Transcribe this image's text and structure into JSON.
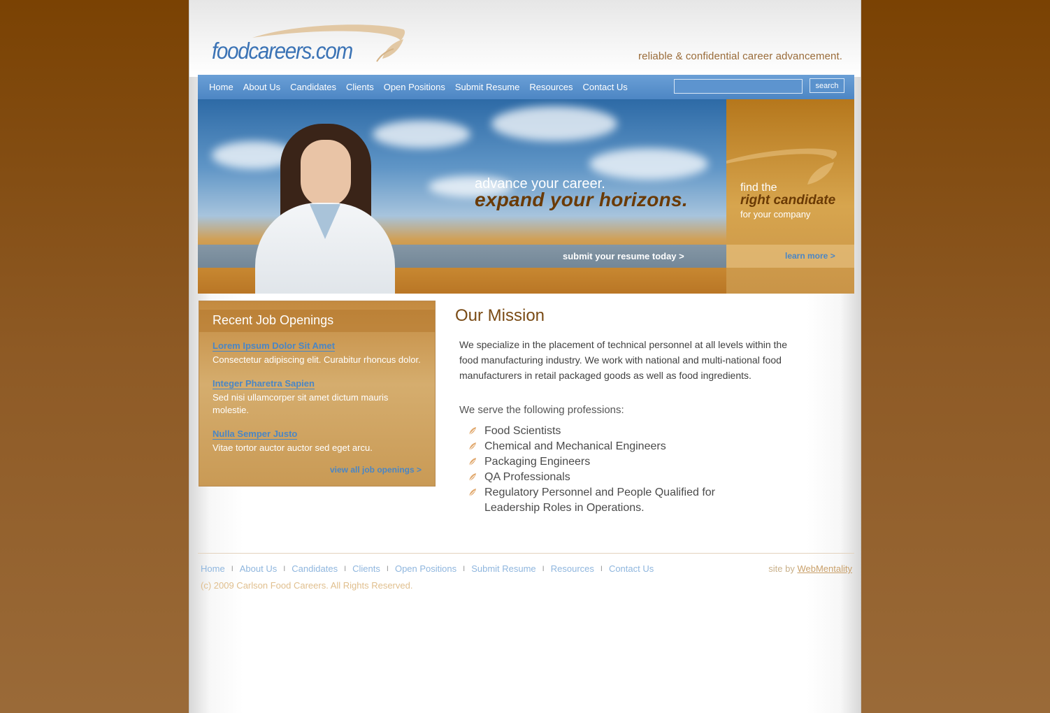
{
  "header": {
    "logo_text": "foodcareers.com",
    "tagline": "reliable & confidential career advancement."
  },
  "nav": {
    "items": [
      {
        "label": "Home"
      },
      {
        "label": "About Us"
      },
      {
        "label": "Candidates"
      },
      {
        "label": "Clients"
      },
      {
        "label": "Open Positions"
      },
      {
        "label": "Submit Resume"
      },
      {
        "label": "Resources"
      },
      {
        "label": "Contact Us"
      }
    ],
    "search_placeholder": "",
    "search_button": "search"
  },
  "hero": {
    "line1": "advance your career.",
    "line2": "expand your horizons.",
    "cta": "submit your resume today >"
  },
  "promo": {
    "line1": "find the",
    "line2": "right candidate",
    "line3": "for your company",
    "cta": "learn more >"
  },
  "jobs": {
    "title": "Recent Job Openings",
    "items": [
      {
        "title": "Lorem Ipsum Dolor Sit Amet",
        "desc": "Consectetur adipiscing elit. Curabitur rhoncus dolor."
      },
      {
        "title": "Integer Pharetra Sapien",
        "desc": "Sed nisi ullamcorper sit amet dictum mauris molestie."
      },
      {
        "title": "Nulla Semper Justo",
        "desc": "Vitae tortor auctor auctor sed eget arcu."
      }
    ],
    "view_all": "view all job openings >"
  },
  "mission": {
    "title": "Our Mission",
    "text": "We specialize in the placement of technical personnel at all levels within the food manufacturing industry.  We work with national and multi-national food manufacturers in retail packaged goods as well as food ingredients.",
    "serve": "We serve the following professions:",
    "professions": [
      "Food Scientists",
      "Chemical and Mechanical Engineers",
      "Packaging Engineers",
      "QA Professionals",
      "Regulatory Personnel and People Qualified for Leadership Roles in Operations."
    ]
  },
  "footer": {
    "links": [
      "Home",
      "About Us",
      "Candidates",
      "Clients",
      "Open Positions",
      "Submit Resume",
      "Resources",
      "Contact Us"
    ],
    "separator": "I",
    "site_by_prefix": "site by",
    "site_by_link": "WebMentality",
    "copyright": "(c) 2009 Carlson Food Careers. All Rights Reserved."
  },
  "colors": {
    "brand_blue": "#4d86c4",
    "brand_brown": "#7a4b15",
    "gold": "#c48a3f"
  }
}
